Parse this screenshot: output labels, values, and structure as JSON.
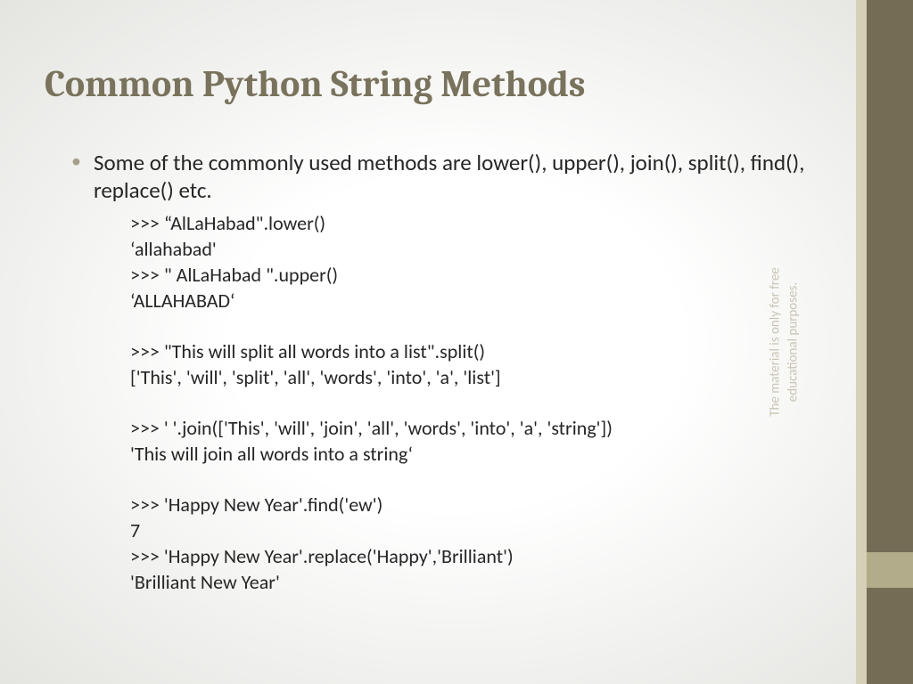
{
  "title": "Common Python String Methods",
  "bullet": "Some of the commonly used methods are lower(), upper(), join(), split(), find(), replace() etc.",
  "code": {
    "l1": ">>> “AlLaHabad\".lower()",
    "l2": "‘allahabad'",
    "l3": ">>> \" AlLaHabad \".upper()",
    "l4": "‘ALLAHABAD‘",
    "l5": ">>> \"This will split all words into a list\".split()",
    "l6": "['This', 'will', 'split', 'all', 'words', 'into', 'a', 'list']",
    "l7": ">>> ' '.join(['This', 'will', 'join', 'all', 'words', 'into', 'a', 'string'])",
    "l8": "'This will join all words into a string‘",
    "l9": ">>> 'Happy New Year'.find('ew')",
    "l10": "7",
    "l11": ">>> 'Happy New Year'.replace('Happy','Brilliant')",
    "l12": "'Brilliant New Year'"
  },
  "sidebar": {
    "line1": "The material is only for free",
    "line2": "educational purposes."
  }
}
